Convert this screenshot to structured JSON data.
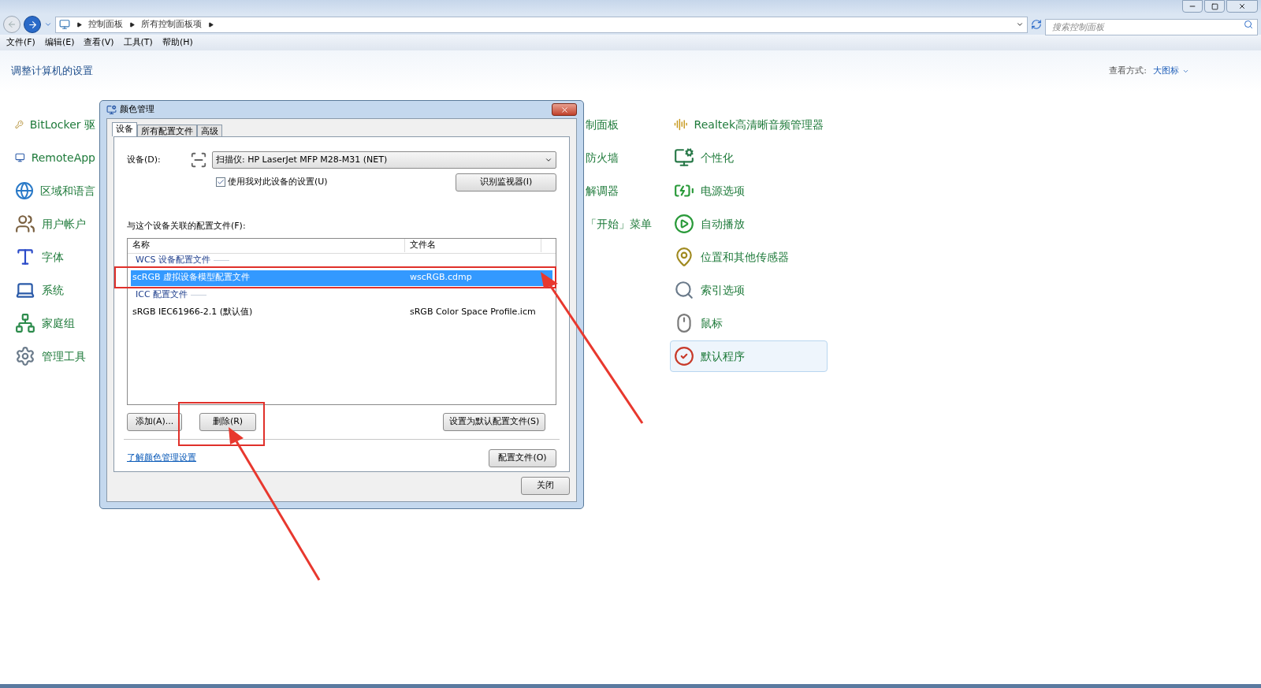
{
  "address_bar": {
    "breadcrumb": [
      "控制面板",
      "所有控制面板项"
    ],
    "search_placeholder": "搜索控制面板"
  },
  "menu": [
    "文件(F)",
    "编辑(E)",
    "查看(V)",
    "工具(T)",
    "帮助(H)"
  ],
  "header": {
    "title": "调整计算机的设置",
    "view_label": "查看方式:",
    "view_value": "大图标"
  },
  "columns": [
    [
      {
        "label": "BitLocker 驱",
        "selected": false
      },
      {
        "label": "RemoteApp",
        "selected": false
      },
      {
        "label": "区域和语言",
        "selected": false
      },
      {
        "label": "用户帐户",
        "selected": false
      },
      {
        "label": "字体",
        "selected": false
      },
      {
        "label": "系统",
        "selected": false
      },
      {
        "label": "家庭组",
        "selected": false
      },
      {
        "label": "管理工具",
        "selected": false
      }
    ],
    [
      {
        "label": "制面板",
        "selected": false
      },
      {
        "label": "防火墙",
        "selected": false
      },
      {
        "label": "解调器",
        "selected": false
      },
      {
        "label": "「开始」菜单",
        "selected": false
      }
    ],
    [
      {
        "label": "Realtek高清晰音频管理器",
        "selected": false
      },
      {
        "label": "个性化",
        "selected": false
      },
      {
        "label": "电源选项",
        "selected": false
      },
      {
        "label": "自动播放",
        "selected": false
      },
      {
        "label": "位置和其他传感器",
        "selected": false
      },
      {
        "label": "索引选项",
        "selected": false
      },
      {
        "label": "鼠标",
        "selected": false
      },
      {
        "label": "默认程序",
        "selected": true
      }
    ]
  ],
  "dialog": {
    "title": "颜色管理",
    "tabs": [
      {
        "label": "设备",
        "selected": true
      },
      {
        "label": "所有配置文件",
        "selected": false
      },
      {
        "label": "高级",
        "selected": false
      }
    ],
    "device_label": "设备(D):",
    "device_value": "扫描仪: HP LaserJet MFP M28-M31 (NET)",
    "use_settings": {
      "label": "使用我对此设备的设置(U)",
      "checked": true
    },
    "identify_button": "识别监视器(I)",
    "profiles_label": "与这个设备关联的配置文件(F):",
    "table": {
      "columns": [
        "名称",
        "文件名"
      ],
      "groups": [
        {
          "name": "WCS 设备配置文件",
          "rows": [
            {
              "name": "scRGB 虚拟设备模型配置文件",
              "file": "wscRGB.cdmp",
              "selected": true
            }
          ]
        },
        {
          "name": "ICC 配置文件",
          "rows": [
            {
              "name": "sRGB IEC61966-2.1 (默认值)",
              "file": "sRGB Color Space Profile.icm",
              "selected": false
            }
          ]
        }
      ]
    },
    "add_button": "添加(A)...",
    "remove_button": "删除(R)",
    "set_default_button": "设置为默认配置文件(S)",
    "link": "了解颜色管理设置",
    "profiles_button": "配置文件(O)",
    "close_button": "关闭"
  }
}
